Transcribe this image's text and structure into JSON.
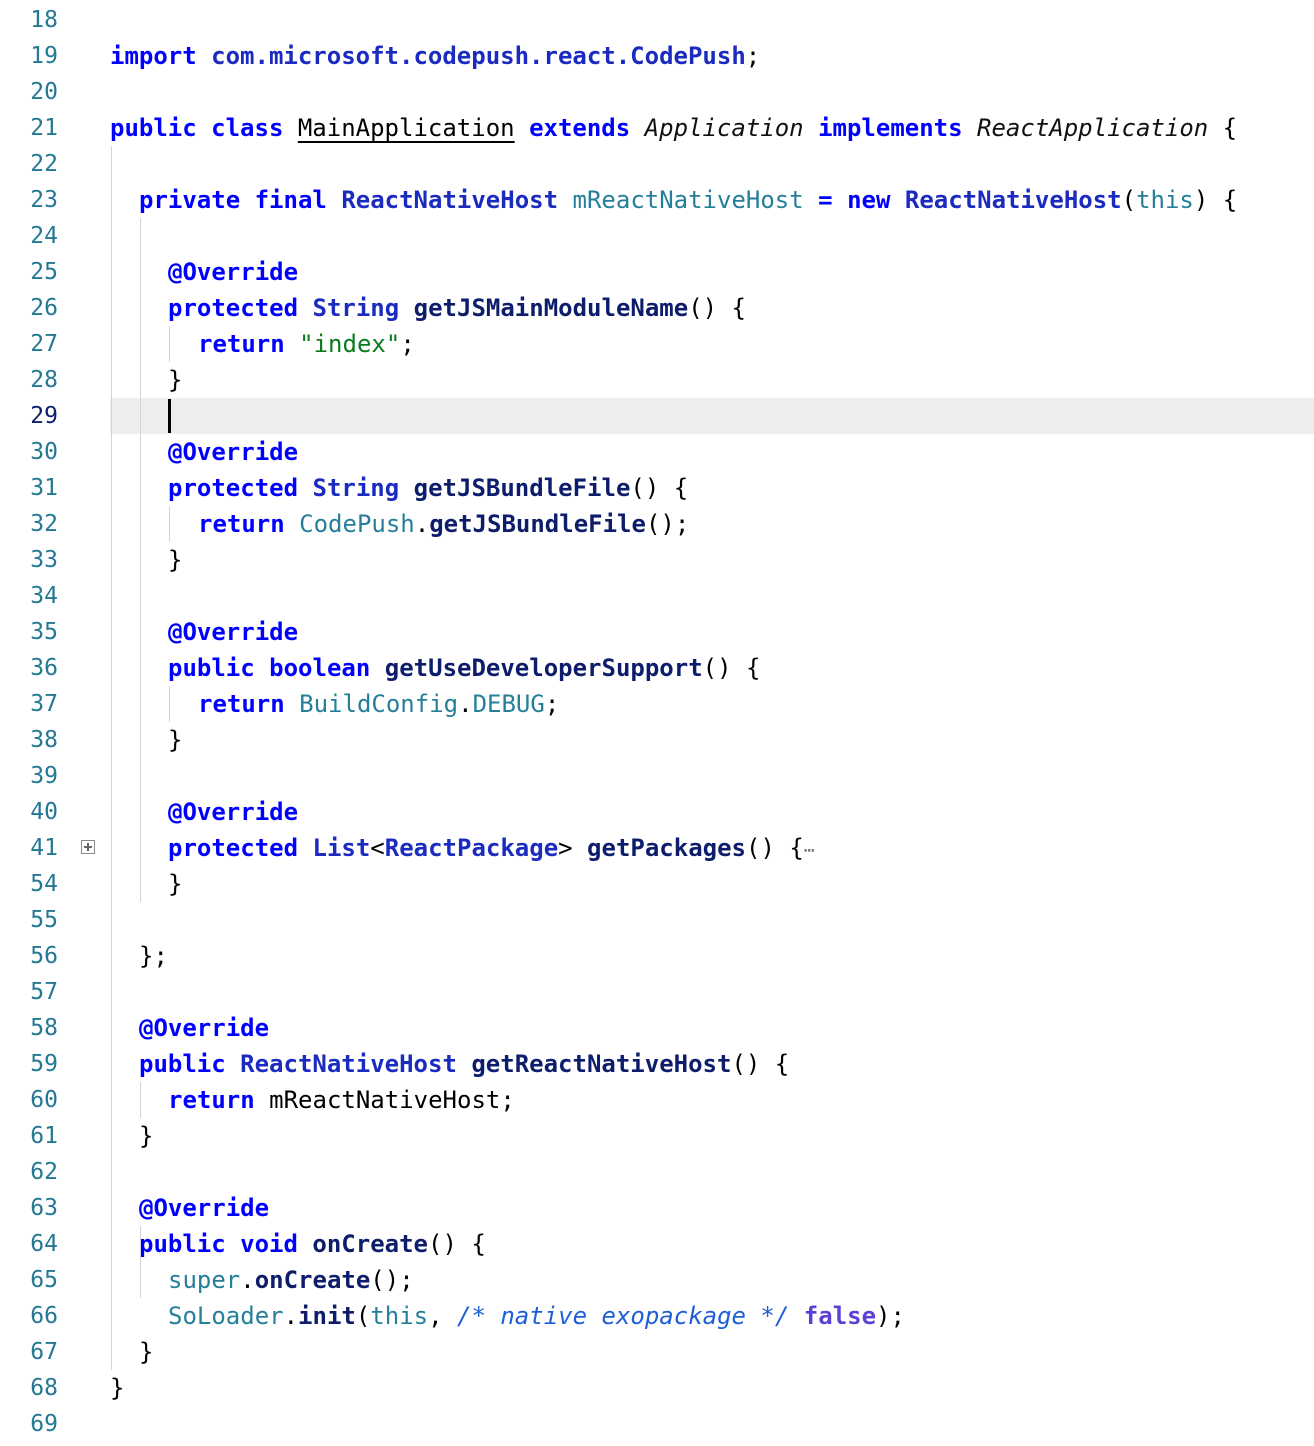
{
  "editor": {
    "language": "java",
    "current_line": "29",
    "lines": [
      {
        "n": "18",
        "tokens": []
      },
      {
        "n": "19",
        "tokens": [
          [
            "import",
            "kw"
          ],
          [
            " ",
            ""
          ],
          [
            "com.microsoft.codepush.react.CodePush",
            "ty"
          ],
          [
            ";",
            ""
          ]
        ]
      },
      {
        "n": "20",
        "tokens": []
      },
      {
        "n": "21",
        "tokens": [
          [
            "public",
            "kw"
          ],
          [
            " ",
            ""
          ],
          [
            "class",
            "kw"
          ],
          [
            " ",
            ""
          ],
          [
            "MainApplication",
            "ul"
          ],
          [
            " ",
            ""
          ],
          [
            "extends",
            "kw"
          ],
          [
            " ",
            ""
          ],
          [
            "Application",
            "it"
          ],
          [
            " ",
            ""
          ],
          [
            "implements",
            "kw"
          ],
          [
            " ",
            ""
          ],
          [
            "ReactApplication",
            "it"
          ],
          [
            " {",
            ""
          ]
        ]
      },
      {
        "n": "22",
        "tokens": []
      },
      {
        "n": "23",
        "tokens": [
          [
            "private",
            "kw"
          ],
          [
            " ",
            ""
          ],
          [
            "final",
            "kw"
          ],
          [
            " ",
            ""
          ],
          [
            "ReactNativeHost",
            "ty"
          ],
          [
            " ",
            ""
          ],
          [
            "mReactNativeHost",
            "id"
          ],
          [
            " ",
            ""
          ],
          [
            "=",
            "kw"
          ],
          [
            " ",
            ""
          ],
          [
            "new",
            "kw"
          ],
          [
            " ",
            ""
          ],
          [
            "ReactNativeHost",
            "ty"
          ],
          [
            "(",
            ""
          ],
          [
            "this",
            "id"
          ],
          [
            ") {",
            ""
          ]
        ]
      },
      {
        "n": "24",
        "tokens": []
      },
      {
        "n": "25",
        "tokens": [
          [
            "@Override",
            "kw"
          ]
        ]
      },
      {
        "n": "26",
        "tokens": [
          [
            "protected",
            "kw"
          ],
          [
            " ",
            ""
          ],
          [
            "String",
            "ty"
          ],
          [
            " ",
            ""
          ],
          [
            "getJSMainModuleName",
            "fn"
          ],
          [
            "() {",
            ""
          ]
        ]
      },
      {
        "n": "27",
        "tokens": [
          [
            "return",
            "kw"
          ],
          [
            " ",
            ""
          ],
          [
            "\"index\"",
            "str"
          ],
          [
            ";",
            ""
          ]
        ]
      },
      {
        "n": "28",
        "tokens": [
          [
            "}",
            ""
          ]
        ]
      },
      {
        "n": "29",
        "tokens": []
      },
      {
        "n": "30",
        "tokens": [
          [
            "@Override",
            "kw"
          ]
        ]
      },
      {
        "n": "31",
        "tokens": [
          [
            "protected",
            "kw"
          ],
          [
            " ",
            ""
          ],
          [
            "String",
            "ty"
          ],
          [
            " ",
            ""
          ],
          [
            "getJSBundleFile",
            "fn"
          ],
          [
            "() {",
            ""
          ]
        ]
      },
      {
        "n": "32",
        "tokens": [
          [
            "return",
            "kw"
          ],
          [
            " ",
            ""
          ],
          [
            "CodePush",
            "id"
          ],
          [
            ".",
            ""
          ],
          [
            "getJSBundleFile",
            "fn"
          ],
          [
            "();",
            ""
          ]
        ]
      },
      {
        "n": "33",
        "tokens": [
          [
            "}",
            ""
          ]
        ]
      },
      {
        "n": "34",
        "tokens": []
      },
      {
        "n": "35",
        "tokens": [
          [
            "@Override",
            "kw"
          ]
        ]
      },
      {
        "n": "36",
        "tokens": [
          [
            "public",
            "kw"
          ],
          [
            " ",
            ""
          ],
          [
            "boolean",
            "kw"
          ],
          [
            " ",
            ""
          ],
          [
            "getUseDeveloperSupport",
            "fn"
          ],
          [
            "() {",
            ""
          ]
        ]
      },
      {
        "n": "37",
        "tokens": [
          [
            "return",
            "kw"
          ],
          [
            " ",
            ""
          ],
          [
            "BuildConfig",
            "id"
          ],
          [
            ".",
            ""
          ],
          [
            "DEBUG",
            "id"
          ],
          [
            ";",
            ""
          ]
        ]
      },
      {
        "n": "38",
        "tokens": [
          [
            "}",
            ""
          ]
        ]
      },
      {
        "n": "39",
        "tokens": []
      },
      {
        "n": "40",
        "tokens": [
          [
            "@Override",
            "kw"
          ]
        ]
      },
      {
        "n": "41",
        "tokens": [
          [
            "protected",
            "kw"
          ],
          [
            " ",
            ""
          ],
          [
            "List",
            "ty"
          ],
          [
            "<",
            ""
          ],
          [
            "ReactPackage",
            "ty"
          ],
          [
            "> ",
            ""
          ],
          [
            "getPackages",
            "fn"
          ],
          [
            "() {",
            ""
          ],
          [
            "⋯",
            "ellipsis"
          ]
        ],
        "folded": true
      },
      {
        "n": "54",
        "tokens": [
          [
            "}",
            ""
          ]
        ]
      },
      {
        "n": "55",
        "tokens": []
      },
      {
        "n": "56",
        "tokens": [
          [
            "};",
            ""
          ]
        ]
      },
      {
        "n": "57",
        "tokens": []
      },
      {
        "n": "58",
        "tokens": [
          [
            "@Override",
            "kw"
          ]
        ]
      },
      {
        "n": "59",
        "tokens": [
          [
            "public",
            "kw"
          ],
          [
            " ",
            ""
          ],
          [
            "ReactNativeHost",
            "ty"
          ],
          [
            " ",
            ""
          ],
          [
            "getReactNativeHost",
            "fn"
          ],
          [
            "() {",
            ""
          ]
        ]
      },
      {
        "n": "60",
        "tokens": [
          [
            "return",
            "kw"
          ],
          [
            " mReactNativeHost;",
            ""
          ]
        ]
      },
      {
        "n": "61",
        "tokens": [
          [
            "}",
            ""
          ]
        ]
      },
      {
        "n": "62",
        "tokens": []
      },
      {
        "n": "63",
        "tokens": [
          [
            "@Override",
            "kw"
          ]
        ]
      },
      {
        "n": "64",
        "tokens": [
          [
            "public",
            "kw"
          ],
          [
            " ",
            ""
          ],
          [
            "void",
            "kw"
          ],
          [
            " ",
            ""
          ],
          [
            "onCreate",
            "fn"
          ],
          [
            "() {",
            ""
          ]
        ]
      },
      {
        "n": "65",
        "tokens": [
          [
            "super",
            "id"
          ],
          [
            ".",
            ""
          ],
          [
            "onCreate",
            "fn"
          ],
          [
            "();",
            ""
          ]
        ]
      },
      {
        "n": "66",
        "tokens": [
          [
            "SoLoader",
            "id"
          ],
          [
            ".",
            ""
          ],
          [
            "init",
            "fn"
          ],
          [
            "(",
            ""
          ],
          [
            "this",
            "id"
          ],
          [
            ", ",
            ""
          ],
          [
            "/* native exopackage */",
            "cm"
          ],
          [
            " ",
            ""
          ],
          [
            "false",
            "lit"
          ],
          [
            ");",
            ""
          ]
        ]
      },
      {
        "n": "67",
        "tokens": [
          [
            "}",
            ""
          ]
        ]
      },
      {
        "n": "68",
        "tokens": [
          [
            "}",
            ""
          ]
        ]
      },
      {
        "n": "69",
        "tokens": []
      }
    ]
  }
}
